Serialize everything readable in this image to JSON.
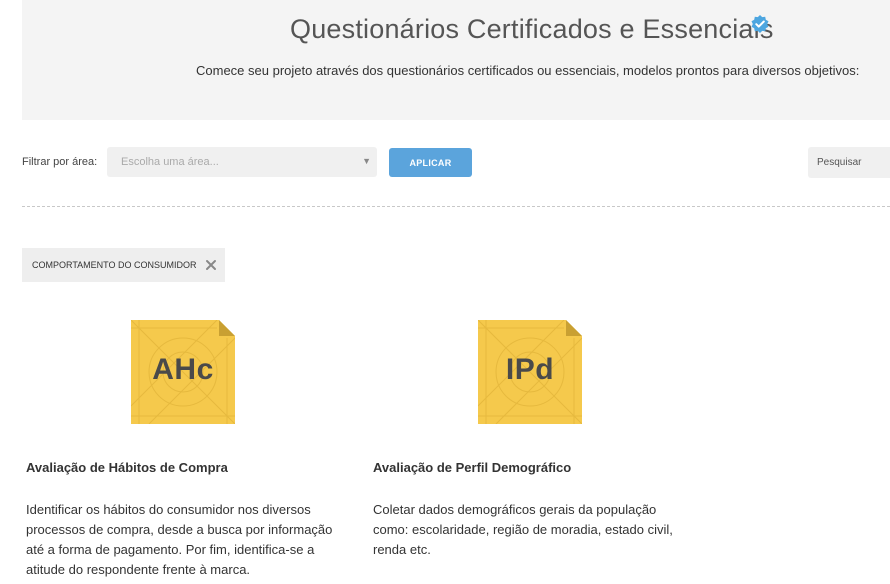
{
  "header": {
    "title": "Questionários Certificados e Essenciais",
    "subtitle": "Comece seu projeto através dos questionários certificados ou essenciais, modelos prontos para diversos objetivos:",
    "verified_icon": "verified-badge-icon",
    "verified_color": "#4da6e0"
  },
  "filter": {
    "label": "Filtrar por área:",
    "select_value": "Escolha uma área...",
    "apply_label": "APLICAR",
    "search_placeholder": "Pesquisar",
    "accent_color": "#5ba4dc"
  },
  "active_filters": [
    {
      "label": "COMPORTAMENTO DO CONSUMIDOR"
    }
  ],
  "cards": [
    {
      "abbr": "AHc",
      "title": "Avaliação de Hábitos de Compra",
      "description": "Identificar os hábitos do consumidor nos diversos processos de compra, desde a busca por informação até a forma de pagamento. Por fim, identifica-se a atitude do respondente frente à marca.",
      "icon_color": "#f5c94c"
    },
    {
      "abbr": "IPd",
      "title": "Avaliação de Perfil Demográfico",
      "description": "Coletar dados demográficos gerais da população como: escolaridade, região de moradia, estado civil, renda etc.",
      "icon_color": "#f5c94c"
    }
  ]
}
